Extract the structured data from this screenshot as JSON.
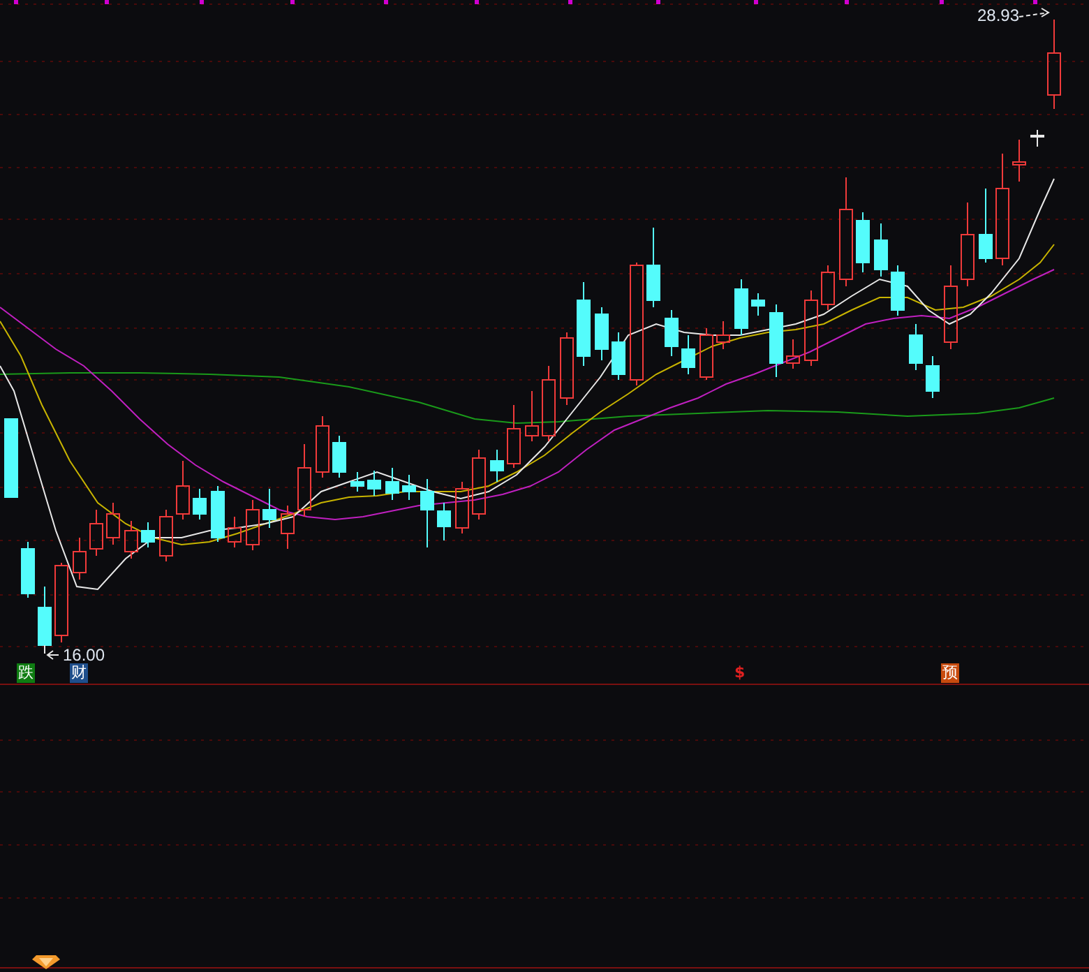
{
  "price_labels": [
    {
      "kind": "high",
      "text": "28.93"
    },
    {
      "kind": "low",
      "text": "16.00"
    }
  ],
  "markers": [
    {
      "kind": "badge",
      "text": "跌",
      "color": "#0f7d12"
    },
    {
      "kind": "badge",
      "text": "财",
      "color": "#1f4f8c"
    },
    {
      "kind": "plain",
      "text": "$",
      "color": "#e02020"
    },
    {
      "kind": "badge",
      "text": "预",
      "color": "#c84b0e"
    }
  ]
}
